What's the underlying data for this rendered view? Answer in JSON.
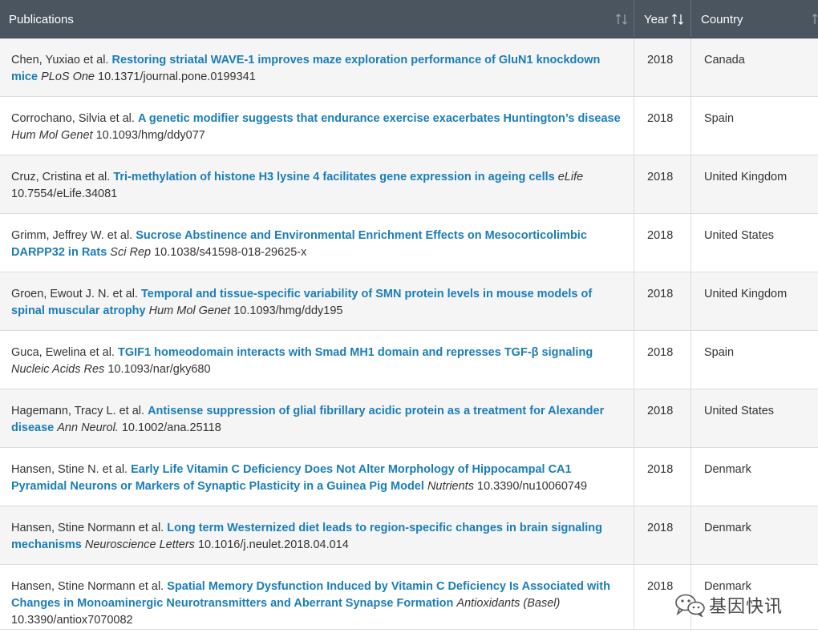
{
  "table": {
    "columns": {
      "publications": "Publications",
      "year": "Year",
      "country": "Country"
    },
    "rows": [
      {
        "authors": "Chen, Yuxiao et al.",
        "title": "Restoring striatal WAVE-1 improves maze exploration performance of GluN1 knockdown mice",
        "journal": "PLoS One",
        "doi": "10.1371/journal.pone.0199341",
        "year": "2018",
        "country": "Canada"
      },
      {
        "authors": "Corrochano, Silvia et al.",
        "title": "A genetic modifier suggests that endurance exercise exacerbates Huntington’s disease",
        "journal": "Hum Mol Genet",
        "doi": "10.1093/hmg/ddy077",
        "year": "2018",
        "country": "Spain"
      },
      {
        "authors": "Cruz, Cristina et al.",
        "title": "Tri-methylation of histone H3 lysine 4 facilitates gene expression in ageing cells",
        "journal": "eLife",
        "doi": "10.7554/eLife.34081",
        "year": "2018",
        "country": "United Kingdom"
      },
      {
        "authors": "Grimm, Jeffrey W. et al.",
        "title": "Sucrose Abstinence and Environmental Enrichment Effects on Mesocorticolimbic DARPP32 in Rats",
        "journal": "Sci Rep",
        "doi": "10.1038/s41598-018-29625-x",
        "year": "2018",
        "country": "United States"
      },
      {
        "authors": "Groen, Ewout J. N. et al.",
        "title": "Temporal and tissue-specific variability of SMN protein levels in mouse models of spinal muscular atrophy",
        "journal": "Hum Mol Genet",
        "doi": "10.1093/hmg/ddy195",
        "year": "2018",
        "country": "United Kingdom"
      },
      {
        "authors": "Guca, Ewelina et al.",
        "title": "TGIF1 homeodomain interacts with Smad MH1 domain and represses TGF-β signaling",
        "journal": "Nucleic Acids Res",
        "doi": "10.1093/nar/gky680",
        "year": "2018",
        "country": "Spain"
      },
      {
        "authors": "Hagemann, Tracy L. et al.",
        "title": "Antisense suppression of glial fibrillary acidic protein as a treatment for Alexander disease",
        "journal": "Ann Neurol.",
        "doi": "10.1002/ana.25118",
        "year": "2018",
        "country": "United States"
      },
      {
        "authors": "Hansen, Stine N. et al.",
        "title": "Early Life Vitamin C Deficiency Does Not Alter Morphology of Hippocampal CA1 Pyramidal Neurons or Markers of Synaptic Plasticity in a Guinea Pig Model",
        "journal": "Nutrients",
        "doi": "10.3390/nu10060749",
        "year": "2018",
        "country": "Denmark"
      },
      {
        "authors": "Hansen, Stine Normann et al.",
        "title": "Long term Westernized diet leads to region-specific changes in brain signaling mechanisms",
        "journal": "Neuroscience Letters",
        "doi": "10.1016/j.neulet.2018.04.014",
        "year": "2018",
        "country": "Denmark"
      },
      {
        "authors": "Hansen, Stine Normann et al.",
        "title": "Spatial Memory Dysfunction Induced by Vitamin C Deficiency Is Associated with Changes in Monoaminergic Neurotransmitters and Aberrant Synapse Formation",
        "journal": "Antioxidants (Basel)",
        "doi": "10.3390/antiox7070082",
        "year": "2018",
        "country": "Denmark"
      }
    ]
  },
  "watermark": {
    "text": "基因快讯",
    "icon": "wechat-icon"
  },
  "colors": {
    "header_bg": "#4a5560",
    "link": "#1a7db8",
    "alt_row": "#f5f5f5"
  },
  "sort_icon": "sort-arrows-icon"
}
